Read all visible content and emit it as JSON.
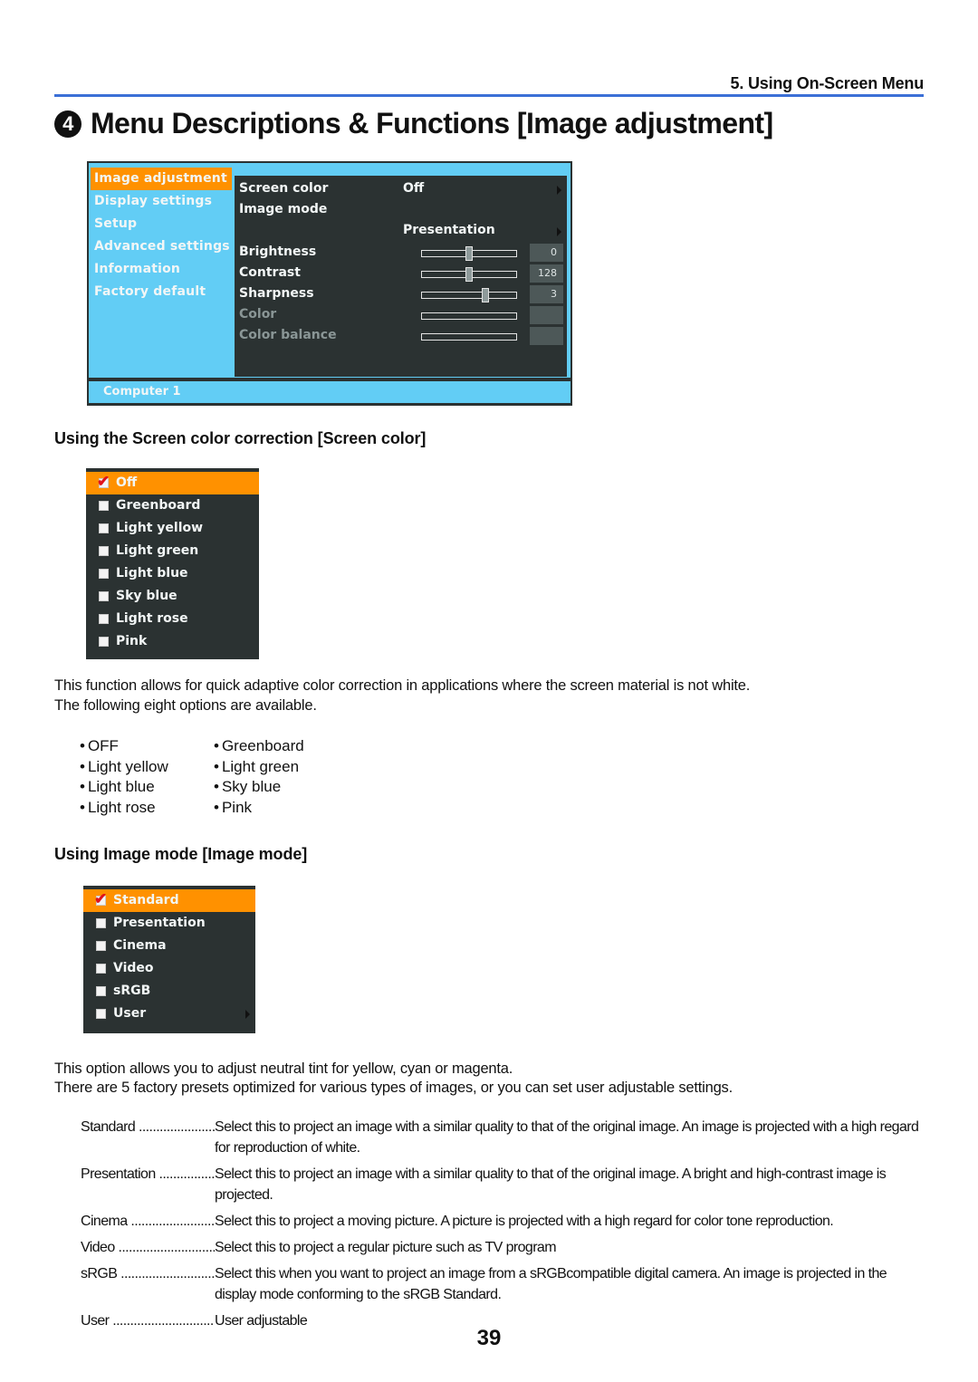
{
  "header": {
    "chapter": "5. Using On-Screen Menu",
    "section_number": "4",
    "title": "Menu Descriptions & Functions [Image adjustment]"
  },
  "osd": {
    "menu": [
      {
        "label": "Image adjustment",
        "selected": true
      },
      {
        "label": "Display settings",
        "selected": false
      },
      {
        "label": "Setup",
        "selected": false
      },
      {
        "label": "Advanced settings",
        "selected": false
      },
      {
        "label": "Information",
        "selected": false
      },
      {
        "label": "Factory default",
        "selected": false
      }
    ],
    "rows": {
      "screen_color": {
        "label": "Screen color",
        "value": "Off"
      },
      "image_mode": {
        "label": "Image mode",
        "value": "Presentation"
      },
      "brightness": {
        "label": "Brightness",
        "value": "0",
        "level": 0.5
      },
      "contrast": {
        "label": "Contrast",
        "value": "128",
        "level": 0.5
      },
      "sharpness": {
        "label": "Sharpness",
        "value": "3",
        "level": 0.67
      },
      "color": {
        "label": "Color",
        "value": ""
      },
      "color_balance": {
        "label": "Color balance",
        "value": ""
      }
    },
    "status": "Computer 1",
    "colors": {
      "highlight": "#ff9100",
      "frame": "#62cdf5",
      "panel": "#2b3232"
    }
  },
  "screen_color": {
    "heading": "Using the Screen color correction [Screen color]",
    "options": [
      "Off",
      "Greenboard",
      "Light yellow",
      "Light green",
      "Light blue",
      "Sky blue",
      "Light rose",
      "Pink"
    ],
    "selected": "Off",
    "para1": "This function allows for quick adaptive color correction in applications where the screen material is not white.",
    "para2": "The following eight options are available.",
    "bullets": [
      "OFF",
      "Greenboard",
      "Light yellow",
      "Light green",
      "Light blue",
      "Sky blue",
      "Light rose",
      "Pink"
    ]
  },
  "image_mode": {
    "heading": "Using Image mode [Image mode]",
    "options": [
      "Standard",
      "Presentation",
      "Cinema",
      "Video",
      "sRGB",
      "User"
    ],
    "selected": "Standard",
    "para1": "This option allows you to adjust neutral tint for yellow, cyan or magenta.",
    "para2": "There are 5 factory presets optimized for various types of images, or you can set user adjustable settings.",
    "descriptions": [
      {
        "name": "Standard",
        "desc": "Select this to project an image with a similar quality to that of the original image. An image is projected with a high regard for reproduction of white."
      },
      {
        "name": "Presentation",
        "desc": "Select this to project an image with a similar quality to that of the original image. A bright and high-contrast image is projected."
      },
      {
        "name": "Cinema",
        "desc": "Select this to project a moving picture. A picture is projected with a high regard for color tone reproduction."
      },
      {
        "name": "Video",
        "desc": "Select this to project a regular picture such as TV program"
      },
      {
        "name": "sRGB",
        "desc": "Select this when you want to project an image from a sRGBcompatible digital camera. An image is projected in the display mode conforming to the sRGB Standard."
      },
      {
        "name": "User",
        "desc": "User adjustable"
      }
    ]
  },
  "page_number": "39"
}
